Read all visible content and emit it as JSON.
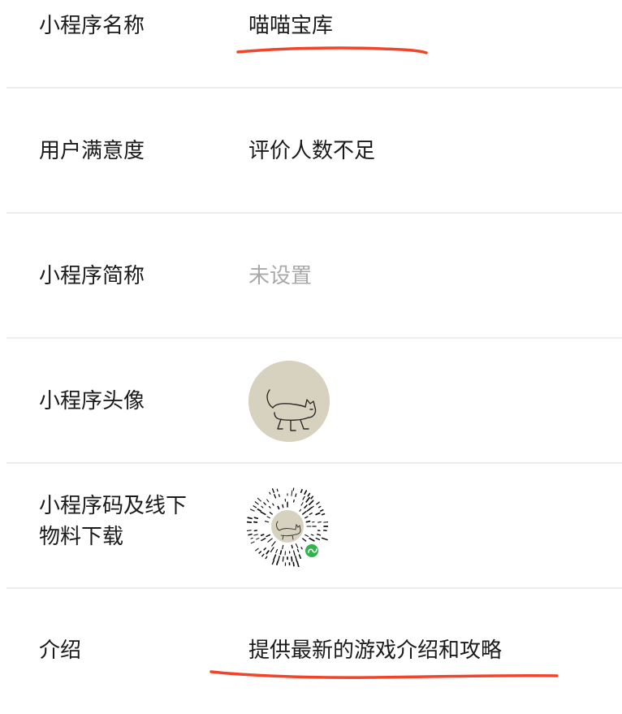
{
  "rows": [
    {
      "label": "小程序名称",
      "value": "喵喵宝库"
    },
    {
      "label": "用户满意度",
      "value": "评价人数不足"
    },
    {
      "label": "小程序简称",
      "value": "未设置"
    },
    {
      "label": "小程序头像"
    },
    {
      "label": "小程序码及线下\n物料下载"
    },
    {
      "label": "介绍",
      "value": "提供最新的游戏介绍和攻略"
    }
  ],
  "colors": {
    "annotation_underline": "#f0452a",
    "placeholder_text": "#a9a9a9",
    "divider": "#ececec",
    "avatar_bg": "#d7d2bf",
    "qr_badge": "#2fb34a"
  },
  "icons": {
    "avatar": "cat-avatar-icon",
    "qr": "mini-program-code-icon"
  }
}
